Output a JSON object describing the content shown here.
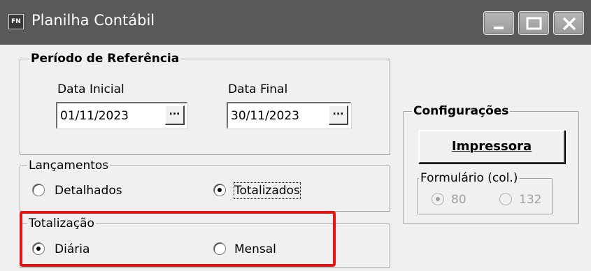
{
  "window": {
    "icon_text": "FN",
    "title": "Planilha Contábil"
  },
  "titlebar_buttons": [
    "minimize",
    "maximize",
    "close"
  ],
  "periodo": {
    "legend": "Período de Referência",
    "data_inicial": {
      "label": "Data Inicial",
      "value": "01/11/2023",
      "button": "..."
    },
    "data_final": {
      "label": "Data Final",
      "value": "30/11/2023",
      "button": "..."
    }
  },
  "lancamentos": {
    "legend": "Lançamentos",
    "options": [
      {
        "label": "Detalhados",
        "checked": false
      },
      {
        "label": "Totalizados",
        "checked": true
      }
    ]
  },
  "totalizacao": {
    "legend": "Totalização",
    "options": [
      {
        "label": "Diária",
        "checked": true
      },
      {
        "label": "Mensal",
        "checked": false
      }
    ]
  },
  "configuracoes": {
    "legend": "Configurações",
    "impressora_button": "Impressora",
    "formulario": {
      "legend": "Formulário (col.)",
      "options": [
        {
          "label": "80",
          "checked": true,
          "disabled": true
        },
        {
          "label": "132",
          "checked": false,
          "disabled": true
        }
      ]
    }
  },
  "colors": {
    "titlebar": "#595959",
    "highlight": "#e01515",
    "background": "#f0f0f0"
  }
}
